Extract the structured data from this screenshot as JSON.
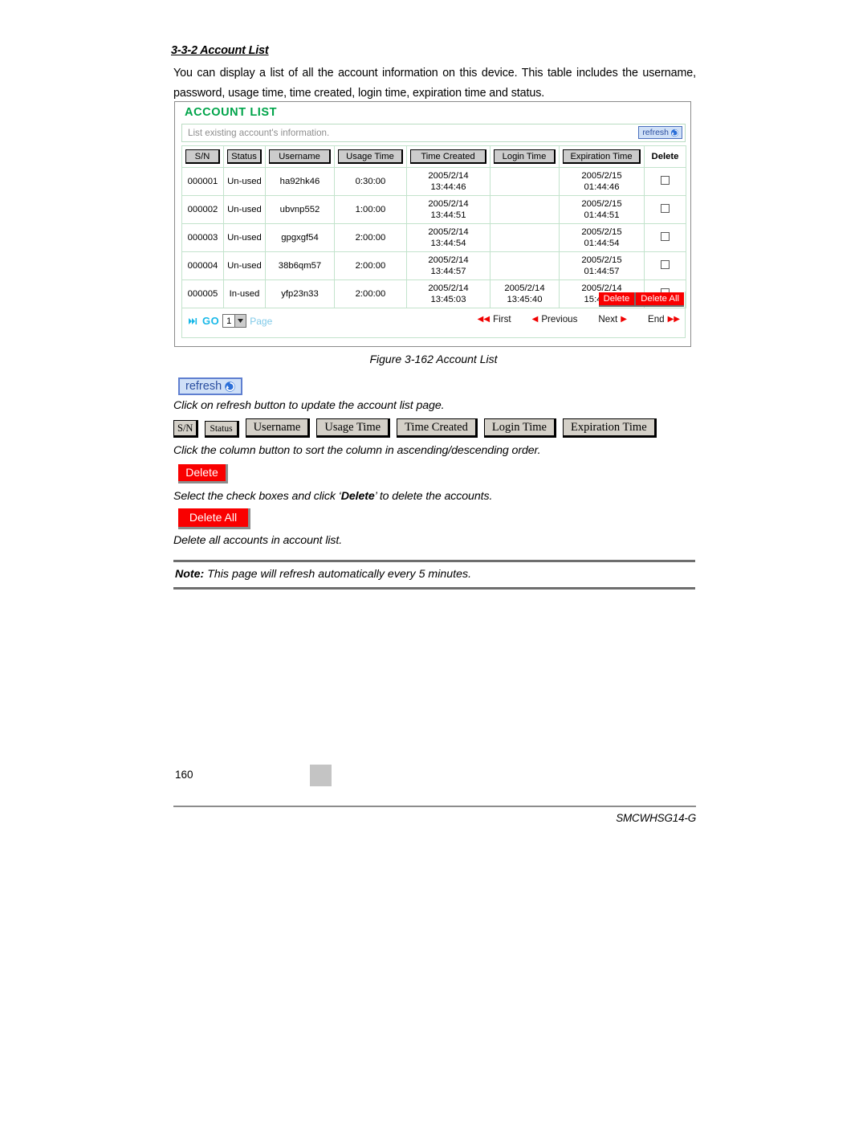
{
  "section": {
    "heading": "3-3-2 Account List",
    "paragraph": "You can display a list of all the account information on this device. This table includes the username, password, usage time, time created, login time, expiration time and status."
  },
  "panel": {
    "title": "ACCOUNT LIST",
    "subtitle": "List existing account's information.",
    "refresh_label": "refresh",
    "columns": [
      "S/N",
      "Status",
      "Username",
      "Usage Time",
      "Time Created",
      "Login Time",
      "Expiration Time"
    ],
    "delete_column_header": "Delete",
    "rows": [
      {
        "sn": "000001",
        "status": "Un-used",
        "status_state": "unused",
        "username": "ha92hk46",
        "usage_time": "0:30:00",
        "time_created_date": "2005/2/14",
        "time_created_time": "13:44:46",
        "login_time_date": "",
        "login_time_time": "",
        "expiration_date": "2005/2/15",
        "expiration_time": "01:44:46"
      },
      {
        "sn": "000002",
        "status": "Un-used",
        "status_state": "unused",
        "username": "ubvnp552",
        "usage_time": "1:00:00",
        "time_created_date": "2005/2/14",
        "time_created_time": "13:44:51",
        "login_time_date": "",
        "login_time_time": "",
        "expiration_date": "2005/2/15",
        "expiration_time": "01:44:51"
      },
      {
        "sn": "000003",
        "status": "Un-used",
        "status_state": "unused",
        "username": "gpgxgf54",
        "usage_time": "2:00:00",
        "time_created_date": "2005/2/14",
        "time_created_time": "13:44:54",
        "login_time_date": "",
        "login_time_time": "",
        "expiration_date": "2005/2/15",
        "expiration_time": "01:44:54"
      },
      {
        "sn": "000004",
        "status": "Un-used",
        "status_state": "unused",
        "username": "38b6qm57",
        "usage_time": "2:00:00",
        "time_created_date": "2005/2/14",
        "time_created_time": "13:44:57",
        "login_time_date": "",
        "login_time_time": "",
        "expiration_date": "2005/2/15",
        "expiration_time": "01:44:57"
      },
      {
        "sn": "000005",
        "status": "In-used",
        "status_state": "inused",
        "username": "yfp23n33",
        "usage_time": "2:00:00",
        "time_created_date": "2005/2/14",
        "time_created_time": "13:45:03",
        "login_time_date": "2005/2/14",
        "login_time_time": "13:45:40",
        "expiration_date": "2005/2/14",
        "expiration_time": "15:45:40"
      }
    ],
    "footer": {
      "delete_label": "Delete",
      "delete_all_label": "Delete All",
      "go_label": "GO",
      "page_value": "1",
      "page_word": "Page",
      "nav_first": "First",
      "nav_previous": "Previous",
      "nav_next": "Next",
      "nav_end": "End"
    }
  },
  "figure_caption": "Figure 3-162 Account List",
  "legend": {
    "refresh_button_label": "refresh",
    "refresh_description": "Click on refresh button to update the account list page.",
    "column_buttons": [
      "S/N",
      "Status",
      "Username",
      "Usage Time",
      "Time Created",
      "Login Time",
      "Expiration Time"
    ],
    "column_description": "Click the column button to sort the column in ascending/descending order.",
    "delete_label": "Delete",
    "delete_description_pre": "Select the check boxes and click ‘",
    "delete_description_bold": "Delete",
    "delete_description_post": "’ to delete the accounts.",
    "delete_all_label": "Delete All",
    "delete_all_description": "Delete all accounts in account list."
  },
  "note": {
    "label": "Note:",
    "text": " This page will refresh automatically every 5 minutes."
  },
  "footer": {
    "page_number": "160",
    "document_id": "SMCWHSG14-G"
  },
  "colors": {
    "panel_title_green": "#00a44a",
    "status_unused_blue": "#2a3fd0",
    "status_inused_orange": "#e06a12",
    "delete_red": "#f90000",
    "refresh_blue": "#2b4fa0",
    "go_cyan": "#18b8e8"
  }
}
